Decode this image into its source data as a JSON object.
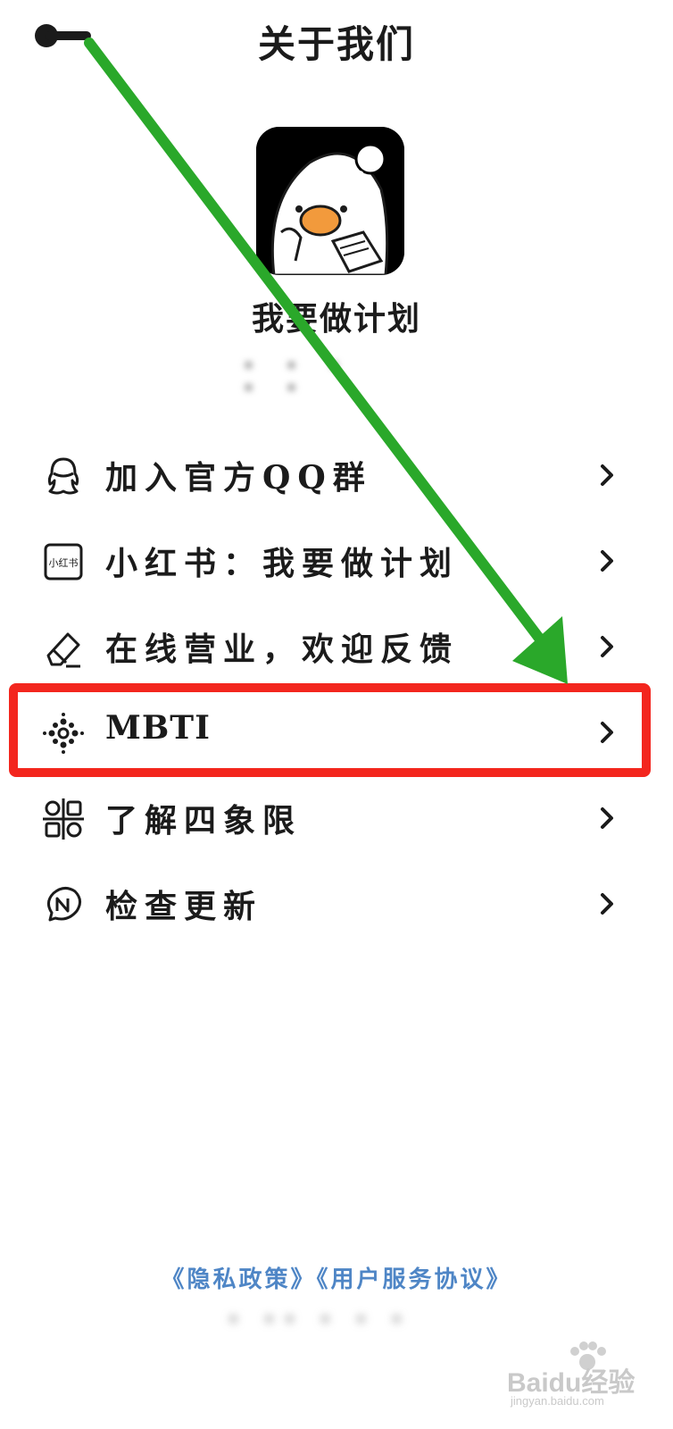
{
  "header": {
    "title": "关于我们",
    "back_icon": "back-arrow-icon"
  },
  "app": {
    "name": "我要做计划",
    "version": "• • • • •"
  },
  "menu": {
    "items": [
      {
        "label": "加入官方QQ群",
        "icon": "qq-icon"
      },
      {
        "label": "小红书：我要做计划",
        "icon": "xiaohongshu-icon",
        "icon_text": "小红书"
      },
      {
        "label": "在线营业，欢迎反馈",
        "icon": "eraser-icon"
      },
      {
        "label": "MBTI",
        "icon": "dots-circle-icon"
      },
      {
        "label": "了解四象限",
        "icon": "quadrant-icon"
      },
      {
        "label": "检查更新",
        "icon": "update-icon"
      }
    ]
  },
  "footer": {
    "privacy_label": "《隐私政策》",
    "terms_label": "《用户服务协议》",
    "copyright": "• •• • • •"
  },
  "watermark": {
    "brand": "Baidu经验",
    "url": "jingyan.baidu.com"
  },
  "annotation": {
    "arrow_color": "#2aa82a",
    "box_color": "#f3261e"
  },
  "colors": {
    "link": "#4f86c6",
    "text": "#1b1b1b"
  }
}
